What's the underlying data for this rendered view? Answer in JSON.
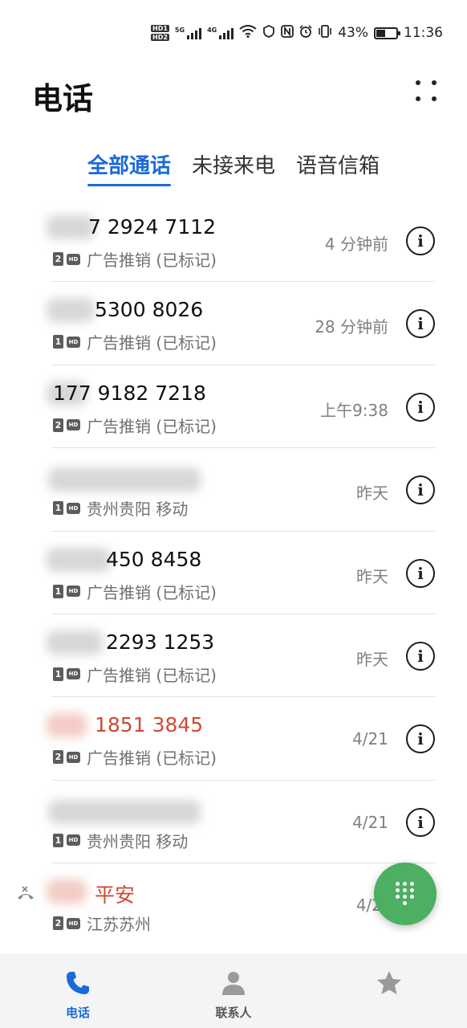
{
  "status_bar": {
    "hd1": "HD1",
    "hd2": "HD2",
    "net1": "5G",
    "net2": "4G",
    "battery": "43%",
    "battery_level": 0.43,
    "time": "11:36"
  },
  "header": {
    "title": "电话"
  },
  "tabs": [
    {
      "label": "全部通话",
      "active": true
    },
    {
      "label": "未接来电",
      "active": false
    },
    {
      "label": "语音信箱",
      "active": false
    }
  ],
  "calls": [
    {
      "number": "7 2924 7112",
      "sim": "2",
      "hd": "HD",
      "label": "广告推销 (已标记)",
      "time": "4 分钟前",
      "missed": false
    },
    {
      "number": "5300 8026",
      "sim": "1",
      "hd": "HD",
      "label": "广告推销 (已标记)",
      "time": "28 分钟前",
      "missed": false
    },
    {
      "number": "177 9182 7218",
      "sim": "2",
      "hd": "HD",
      "label": "广告推销 (已标记)",
      "time": "上午9:38",
      "missed": false
    },
    {
      "number": "",
      "sim": "1",
      "hd": "HD",
      "label": "贵州贵阳 移动",
      "time": "昨天",
      "missed": false
    },
    {
      "number": "450 8458",
      "sim": "1",
      "hd": "HD",
      "label": "广告推销 (已标记)",
      "time": "昨天",
      "missed": false
    },
    {
      "number": "2293 1253",
      "sim": "1",
      "hd": "HD",
      "label": "广告推销 (已标记)",
      "time": "昨天",
      "missed": false
    },
    {
      "number": "1851 3845",
      "sim": "2",
      "hd": "HD",
      "label": "广告推销 (已标记)",
      "time": "4/21",
      "missed": true
    },
    {
      "number": "",
      "sim": "1",
      "hd": "HD",
      "label": "贵州贵阳 移动",
      "time": "4/21",
      "missed": false
    },
    {
      "number": "平安",
      "sim": "2",
      "hd": "HD",
      "label": "江苏苏州",
      "time": "4/2",
      "missed": true
    }
  ],
  "bottom_nav": [
    {
      "label": "电话",
      "icon": "phone-icon",
      "active": true
    },
    {
      "label": "联系人",
      "icon": "contacts-icon",
      "active": false
    },
    {
      "label": "",
      "icon": "star-icon",
      "active": false
    }
  ],
  "colors": {
    "accent": "#1a6ad8",
    "missed": "#cf4a33",
    "fab": "#4caf62"
  }
}
